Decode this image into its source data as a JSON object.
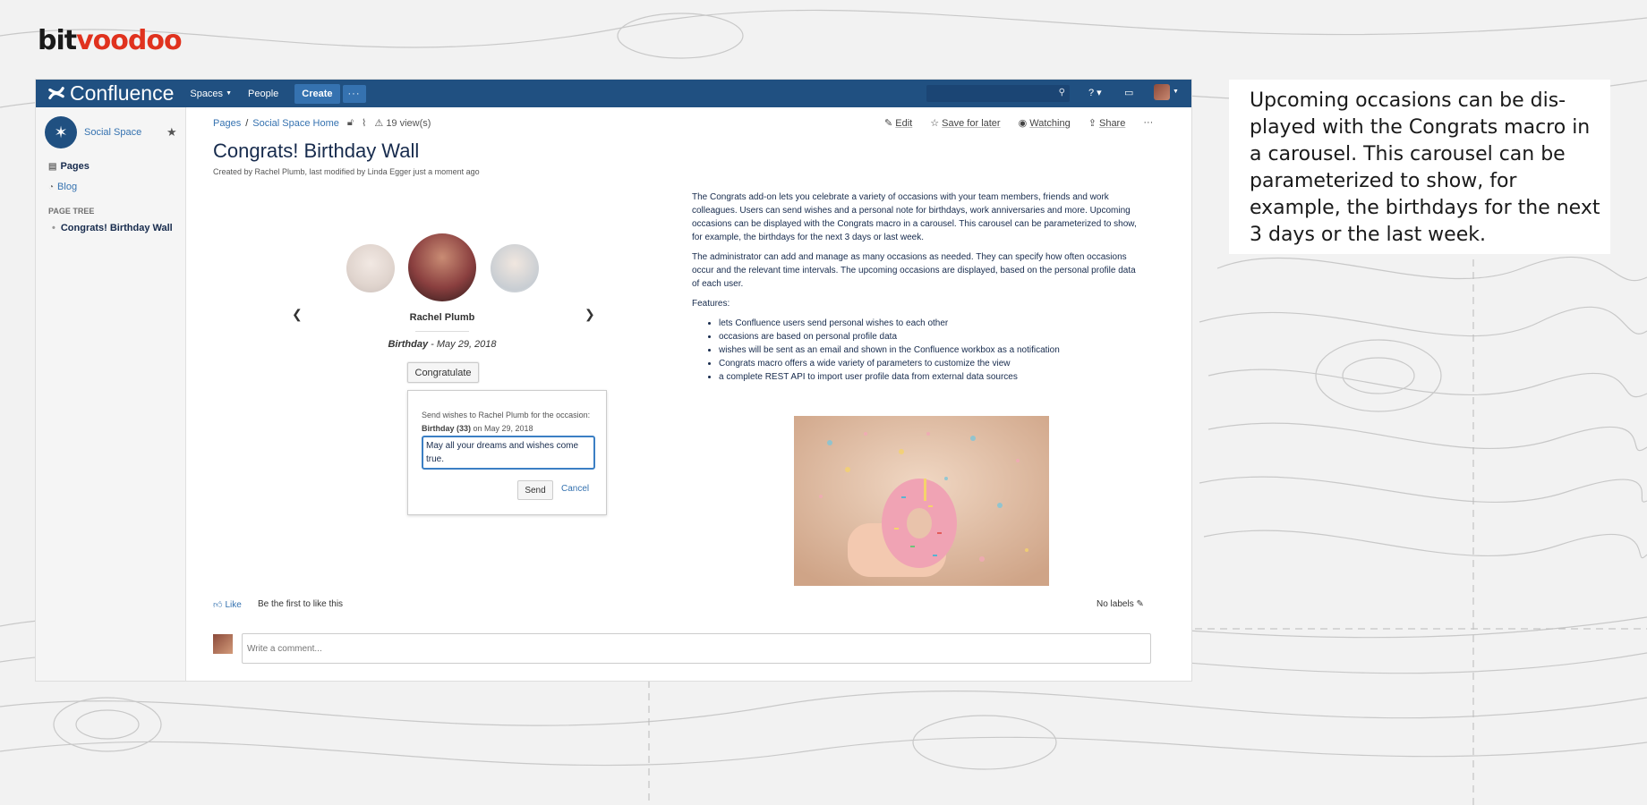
{
  "brand_logo": {
    "part1": "bit",
    "part2": "voodoo"
  },
  "app": {
    "product_name": "Confluence",
    "nav": {
      "spaces": "Spaces",
      "people": "People",
      "create": "Create",
      "more": "···"
    },
    "search_placeholder": ""
  },
  "sidebar": {
    "space_name": "Social Space",
    "pages": "Pages",
    "blog": "Blog",
    "page_tree_heading": "PAGE TREE",
    "page_tree_item": "Congrats! Birthday Wall"
  },
  "breadcrumb": {
    "pages": "Pages",
    "sep": "/",
    "space_home": "Social Space Home",
    "views": "19 view(s)"
  },
  "toolbar": {
    "edit": "Edit",
    "save_for_later": "Save for later",
    "watching": "Watching",
    "share": "Share",
    "more": "···"
  },
  "page": {
    "title": "Congrats! Birthday Wall",
    "byline": "Created by Rachel Plumb, last modified by Linda Egger just a moment ago"
  },
  "carousel": {
    "person_name": "Rachel Plumb",
    "occasion_label": "Birthday",
    "occasion_date": " - May 29, 2018",
    "congratulate_button": "Congratulate"
  },
  "popup": {
    "message_prefix": "Send wishes to Rachel Plumb for the occasion: ",
    "occasion": "Birthday (33)",
    "message_suffix": " on May 29, 2018",
    "wish_text": "May all your dreams and wishes come true.",
    "send_button": "Send",
    "cancel_link": "Cancel"
  },
  "description": {
    "paragraph1": "The Congrats add-on lets you celebrate a variety of occasions with your team members, friends and work colleagues. Users can send wishes and a personal note for birthdays, work anniversaries and more. Upcoming occasions can be displayed with the Congrats macro in a carousel. This carousel can be parameterized to show, for example, the birthdays for the next 3 days or last week.",
    "paragraph2": "The administrator can add and manage as many occasions as needed. They can specify how often occasions occur and the relevant time intervals. The upcoming occasions are displayed, based on the personal profile data of each user.",
    "features_heading": "Features:",
    "features": [
      "lets Confluence users send personal wishes to each other",
      "occasions are based on personal profile data",
      "wishes will be sent as an email and shown in the Confluence workbox as a notification",
      "Congrats macro offers a wide variety of parameters to customize the view",
      "a complete REST API to import user profile data from external data sources"
    ]
  },
  "footer": {
    "like": "Like",
    "like_text": "Be the first to like this",
    "no_labels": "No labels",
    "comment_placeholder": "Write a comment..."
  },
  "side_note": {
    "text": "Upcoming occasions can be dis-played with the Congrats macro in a carousel. This carousel can be parameterized to show, for example, the birthdays for the next 3 days or the last week."
  },
  "colors": {
    "header": "#205081",
    "link": "#3572b0",
    "accent_red": "#e0321e"
  }
}
